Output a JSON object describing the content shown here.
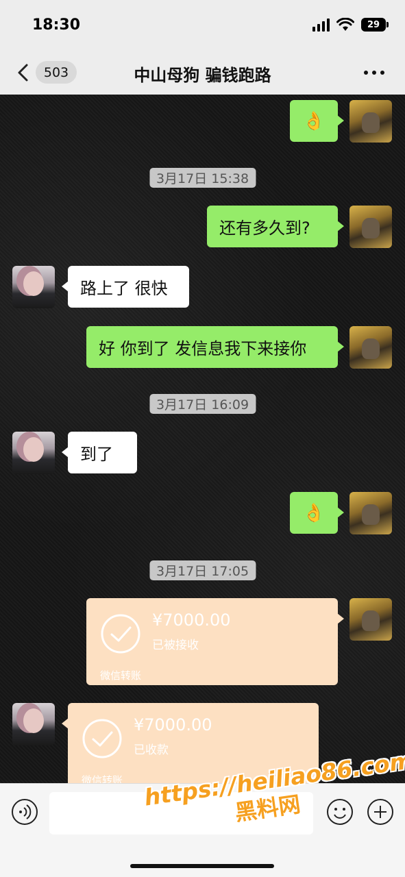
{
  "status_bar": {
    "time": "18:30",
    "battery": "29"
  },
  "header": {
    "unread_count": "503",
    "title": "中山母狗 骗钱跑路"
  },
  "messages": {
    "m1_emoji": "👌",
    "ts1": "3月17日 15:38",
    "m2": "还有多久到?",
    "m3": "路上了  很快",
    "m4": "好  你到了 发信息我下来接你",
    "ts2": "3月17日 16:09",
    "m5": "到了",
    "m6_emoji": "👌",
    "ts3": "3月17日 17:05"
  },
  "transfers": [
    {
      "amount": "¥7000.00",
      "status": "已被接收",
      "label": "微信转账"
    },
    {
      "amount": "¥7000.00",
      "status": "已收款",
      "label": "微信转账"
    }
  ],
  "input": {
    "placeholder": ""
  },
  "watermark": {
    "url": "https://heiliao86.com",
    "name": "黑料网"
  },
  "colors": {
    "sent_bubble": "#95ec69",
    "received_bubble": "#ffffff",
    "transfer_bubble": "#fde0c2",
    "header_bg": "#ededed",
    "watermark": "#f6a020"
  },
  "icons": [
    "back-icon",
    "more-icon",
    "signal-icon",
    "wifi-icon",
    "battery-icon",
    "check-icon",
    "voice-icon",
    "emoji-icon",
    "plus-icon"
  ]
}
